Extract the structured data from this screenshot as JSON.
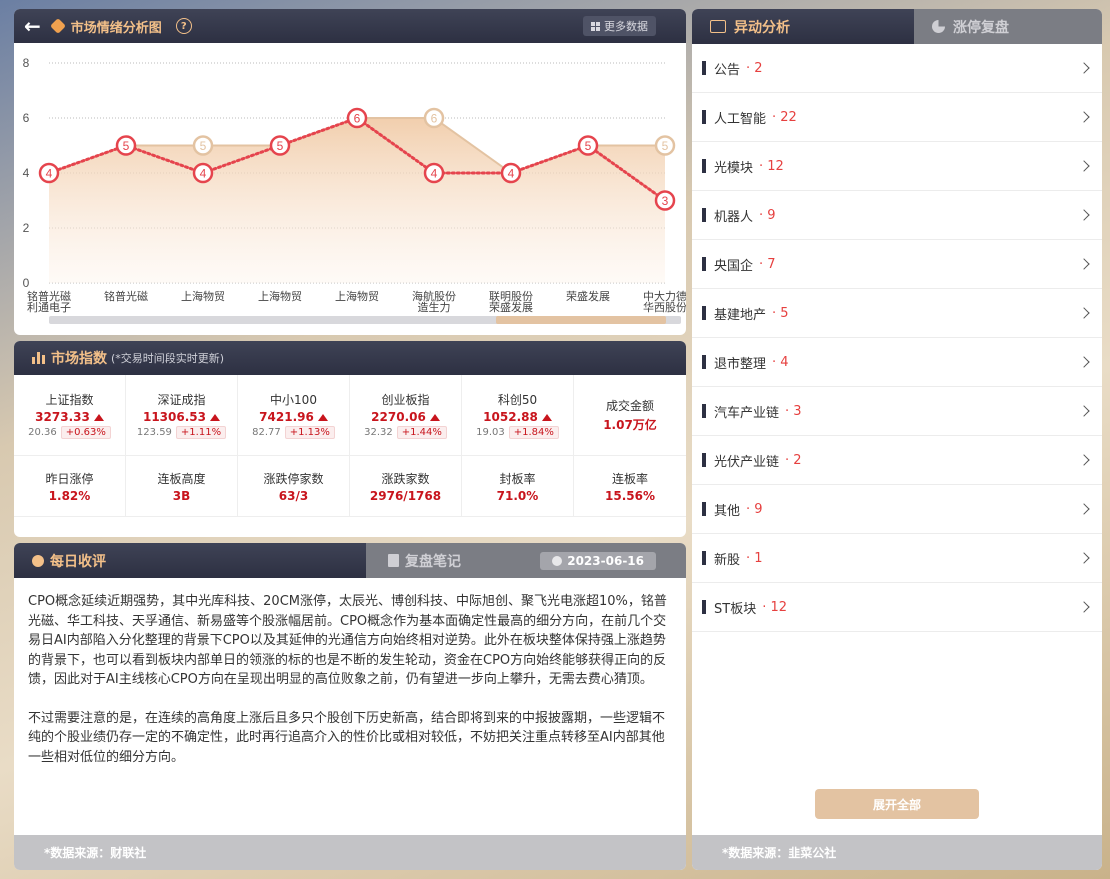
{
  "header": {
    "title": "市场情绪分析图",
    "help": "?",
    "more_data": "更多数据"
  },
  "chart_data": {
    "type": "line",
    "categories": [
      [
        "铭普光磁",
        "利通电子"
      ],
      [
        "铭普光磁"
      ],
      [
        "上海物贸"
      ],
      [
        "上海物贸"
      ],
      [
        "上海物贸"
      ],
      [
        "海航股份",
        "造生力"
      ],
      [
        "联明股份",
        "荣盛发展"
      ],
      [
        "荣盛发展"
      ],
      [
        "中大力德",
        "华西股份"
      ]
    ],
    "series": [
      {
        "values": [
          4,
          5,
          4,
          5,
          6,
          4,
          4,
          5,
          3
        ],
        "color": "#e5444d"
      },
      {
        "values": [
          4,
          5,
          5,
          5,
          6,
          6,
          4,
          5,
          5
        ],
        "color": "#e3c3a2"
      }
    ],
    "yticks": [
      0,
      2,
      4,
      6,
      8
    ],
    "ylim": [
      0,
      8
    ],
    "grid": true
  },
  "market_index": {
    "title": "市场指数",
    "note": "(*交易时间段实时更新)",
    "indices": [
      {
        "name": "上证指数",
        "value": "3273.33",
        "change": "20.36",
        "pct": "+0.63%"
      },
      {
        "name": "深证成指",
        "value": "11306.53",
        "change": "123.59",
        "pct": "+1.11%"
      },
      {
        "name": "中小100",
        "value": "7421.96",
        "change": "82.77",
        "pct": "+1.13%"
      },
      {
        "name": "创业板指",
        "value": "2270.06",
        "change": "32.32",
        "pct": "+1.44%"
      },
      {
        "name": "科创50",
        "value": "1052.88",
        "change": "19.03",
        "pct": "+1.84%"
      }
    ],
    "turnover": {
      "name": "成交金额",
      "value": "1.07万亿"
    },
    "stats": [
      {
        "name": "昨日涨停",
        "value": "1.82%"
      },
      {
        "name": "连板高度",
        "value": "3B"
      },
      {
        "name": "涨跌停家数",
        "value": "63/3"
      },
      {
        "name": "涨跌家数",
        "value": "2976/1768"
      },
      {
        "name": "封板率",
        "value": "71.0%"
      },
      {
        "name": "连板率",
        "value": "15.56%"
      }
    ]
  },
  "review": {
    "tab_active": "每日收评",
    "tab_inactive": "复盘笔记",
    "date": "2023-06-16",
    "paragraphs": [
      "CPO概念延续近期强势，其中光库科技、20CM涨停，太辰光、博创科技、中际旭创、聚飞光电涨超10%，铭普光磁、华工科技、天孚通信、新易盛等个股涨幅居前。CPO概念作为基本面确定性最高的细分方向，在前几个交易日AI内部陷入分化整理的背景下CPO以及其延伸的光通信方向始终相对逆势。此外在板块整体保持强上涨趋势的背景下，也可以看到板块内部单日的领涨的标的也是不断的发生轮动，资金在CPO方向始终能够获得正向的反馈，因此对于AI主线核心CPO方向在呈现出明显的高位败象之前，仍有望进一步向上攀升，无需去费心猜顶。",
      "不过需要注意的是，在连续的高角度上涨后且多只个股创下历史新高，结合即将到来的中报披露期，一些逻辑不纯的个股业绩仍存一定的不确定性，此时再行追高介入的性价比或相对较低，不妨把关注重点转移至AI内部其他一些相对低位的细分方向。"
    ],
    "source": "*数据来源：财联社"
  },
  "anomaly": {
    "tab_active": "异动分析",
    "tab_inactive": "涨停复盘",
    "items": [
      {
        "label": "公告",
        "count": "· 2"
      },
      {
        "label": "人工智能",
        "count": "· 22"
      },
      {
        "label": "光模块",
        "count": "· 12"
      },
      {
        "label": "机器人",
        "count": "· 9"
      },
      {
        "label": "央国企",
        "count": "· 7"
      },
      {
        "label": "基建地产",
        "count": "· 5"
      },
      {
        "label": "退市整理",
        "count": "· 4"
      },
      {
        "label": "汽车产业链",
        "count": "· 3"
      },
      {
        "label": "光伏产业链",
        "count": "· 2"
      },
      {
        "label": "其他",
        "count": "· 9"
      },
      {
        "label": "新股",
        "count": "· 1"
      },
      {
        "label": "ST板块",
        "count": "· 12"
      }
    ],
    "expand_label": "展开全部",
    "source": "*数据来源：韭菜公社"
  }
}
